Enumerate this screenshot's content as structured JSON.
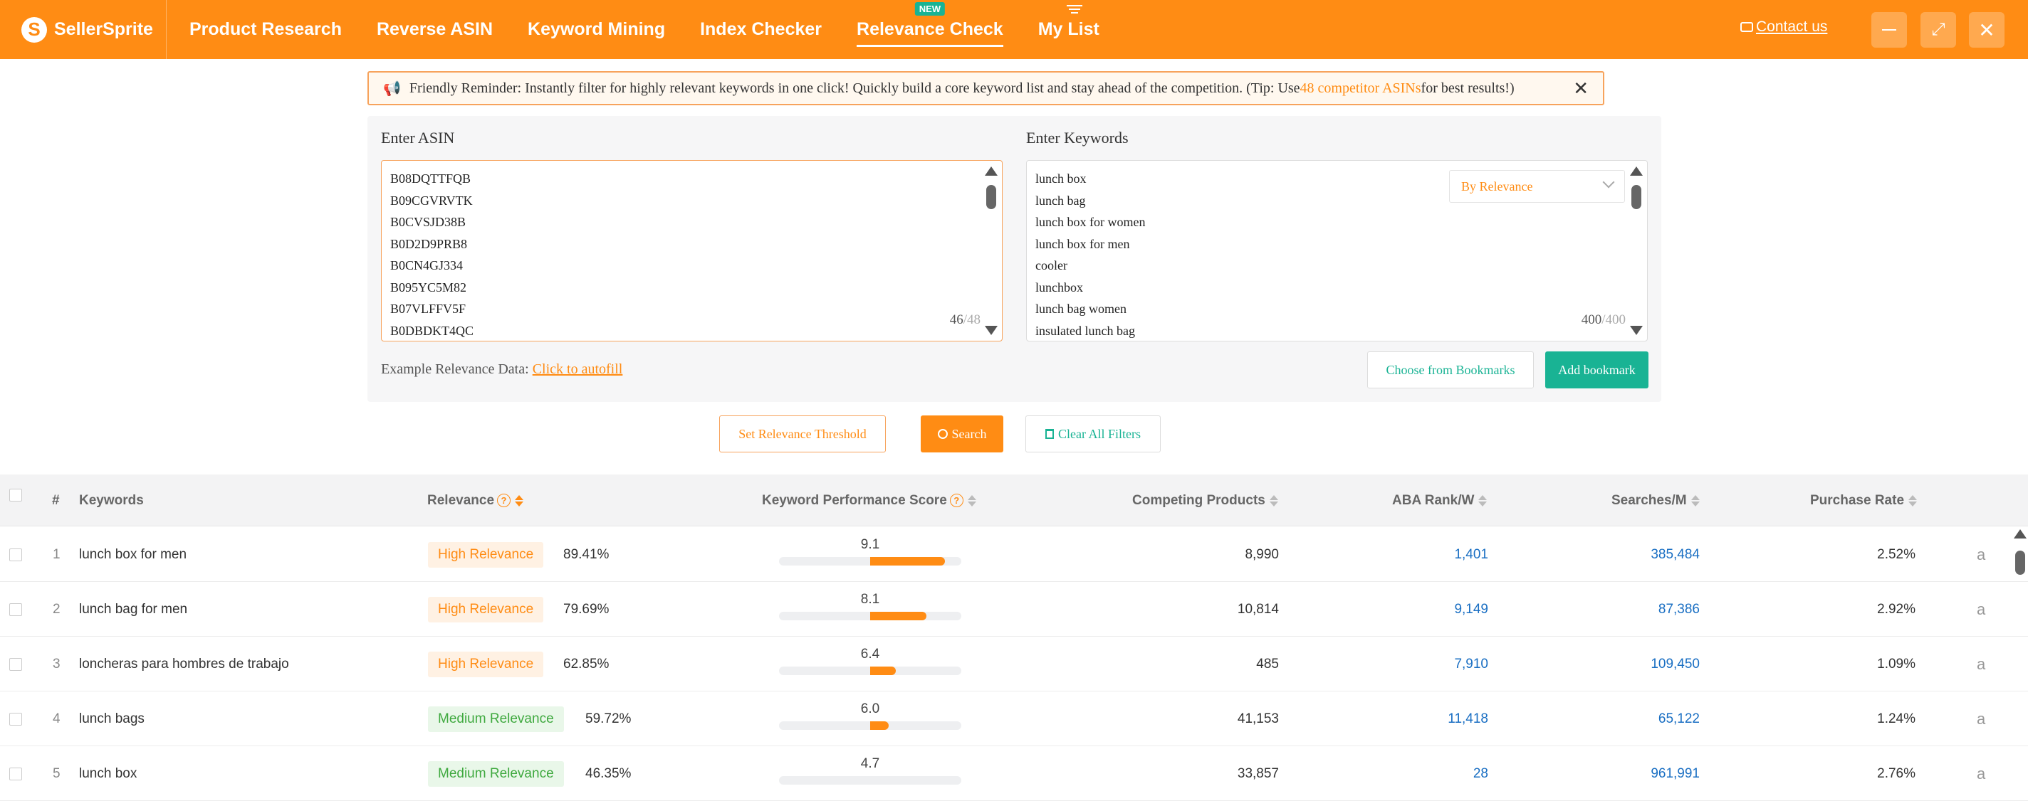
{
  "app": {
    "logo_mark": "S",
    "logo_text": "SellerSprite",
    "nav": [
      {
        "label": "Product Research"
      },
      {
        "label": "Reverse ASIN"
      },
      {
        "label": "Keyword Mining"
      },
      {
        "label": "Index Checker"
      },
      {
        "label": "Relevance Check",
        "badge": "NEW",
        "active": true
      },
      {
        "label": "My List"
      }
    ],
    "contact_label": "Contact us",
    "window_buttons": [
      "minimize-icon",
      "maximize-icon",
      "close-icon"
    ]
  },
  "reminder": {
    "prefix": "Friendly Reminder: Instantly filter for highly relevant keywords in one click! Quickly build a core keyword list and stay ahead of the competition. (Tip: Use ",
    "highlight": "48 competitor ASINs",
    "suffix": " for best results!)",
    "close": "✕"
  },
  "input_panel": {
    "asin_label": "Enter ASIN",
    "asins": [
      "B08DQTTFQB",
      "B09CGVRVTK",
      "B0CVSJD38B",
      "B0D2D9PRB8",
      "B0CN4GJ334",
      "B095YC5M82",
      "B07VLFFV5F",
      "B0DBDKT4QC"
    ],
    "asin_count": "46",
    "asin_max": "/48",
    "keywords_label": "Enter Keywords",
    "keywords": [
      "lunch box",
      "lunch bag",
      "lunch box for women",
      "lunch box for men",
      "cooler",
      "lunchbox",
      "lunch bag women",
      "insulated lunch bag"
    ],
    "keyword_count": "400",
    "keyword_max": "/400",
    "sort_select": "By Relevance",
    "example_label": "Example Relevance Data: ",
    "example_link": "Click to autofill",
    "choose_bookmarks": "Choose from Bookmarks",
    "add_bookmark": "Add bookmark"
  },
  "actions": {
    "threshold": "Set Relevance Threshold",
    "search": "Search",
    "clear": "Clear All Filters"
  },
  "table": {
    "headers": {
      "index": "#",
      "keywords": "Keywords",
      "relevance": "Relevance",
      "score": "Keyword Performance Score",
      "competing": "Competing Products",
      "aba": "ABA Rank/W",
      "searches": "Searches/M",
      "purchase": "Purchase Rate"
    },
    "rows": [
      {
        "n": "1",
        "keyword": "lunch box for men",
        "relevance": "High Relevance",
        "level": "high",
        "pct": "89.41%",
        "score": "9.1",
        "score_value": 9.1,
        "competing": "8,990",
        "aba": "1,401",
        "searches": "385,484",
        "purchase": "2.52%"
      },
      {
        "n": "2",
        "keyword": "lunch bag for men",
        "relevance": "High Relevance",
        "level": "high",
        "pct": "79.69%",
        "score": "8.1",
        "score_value": 8.1,
        "competing": "10,814",
        "aba": "9,149",
        "searches": "87,386",
        "purchase": "2.92%"
      },
      {
        "n": "3",
        "keyword": "loncheras para hombres de trabajo",
        "relevance": "High Relevance",
        "level": "high",
        "pct": "62.85%",
        "score": "6.4",
        "score_value": 6.4,
        "competing": "485",
        "aba": "7,910",
        "searches": "109,450",
        "purchase": "1.09%"
      },
      {
        "n": "4",
        "keyword": "lunch bags",
        "relevance": "Medium Relevance",
        "level": "medium",
        "pct": "59.72%",
        "score": "6.0",
        "score_value": 6.0,
        "competing": "41,153",
        "aba": "11,418",
        "searches": "65,122",
        "purchase": "1.24%"
      },
      {
        "n": "5",
        "keyword": "lunch box",
        "relevance": "Medium Relevance",
        "level": "medium",
        "pct": "46.35%",
        "score": "4.7",
        "score_value": 4.7,
        "competing": "33,857",
        "aba": "28",
        "searches": "961,991",
        "purchase": "2.76%"
      }
    ],
    "amazon_icon": "a"
  },
  "colors": {
    "brand": "#ff8c14",
    "teal": "#19b394",
    "link_blue": "#1a6fc3",
    "high": "#ff8c14",
    "medium": "#3fa93f"
  }
}
